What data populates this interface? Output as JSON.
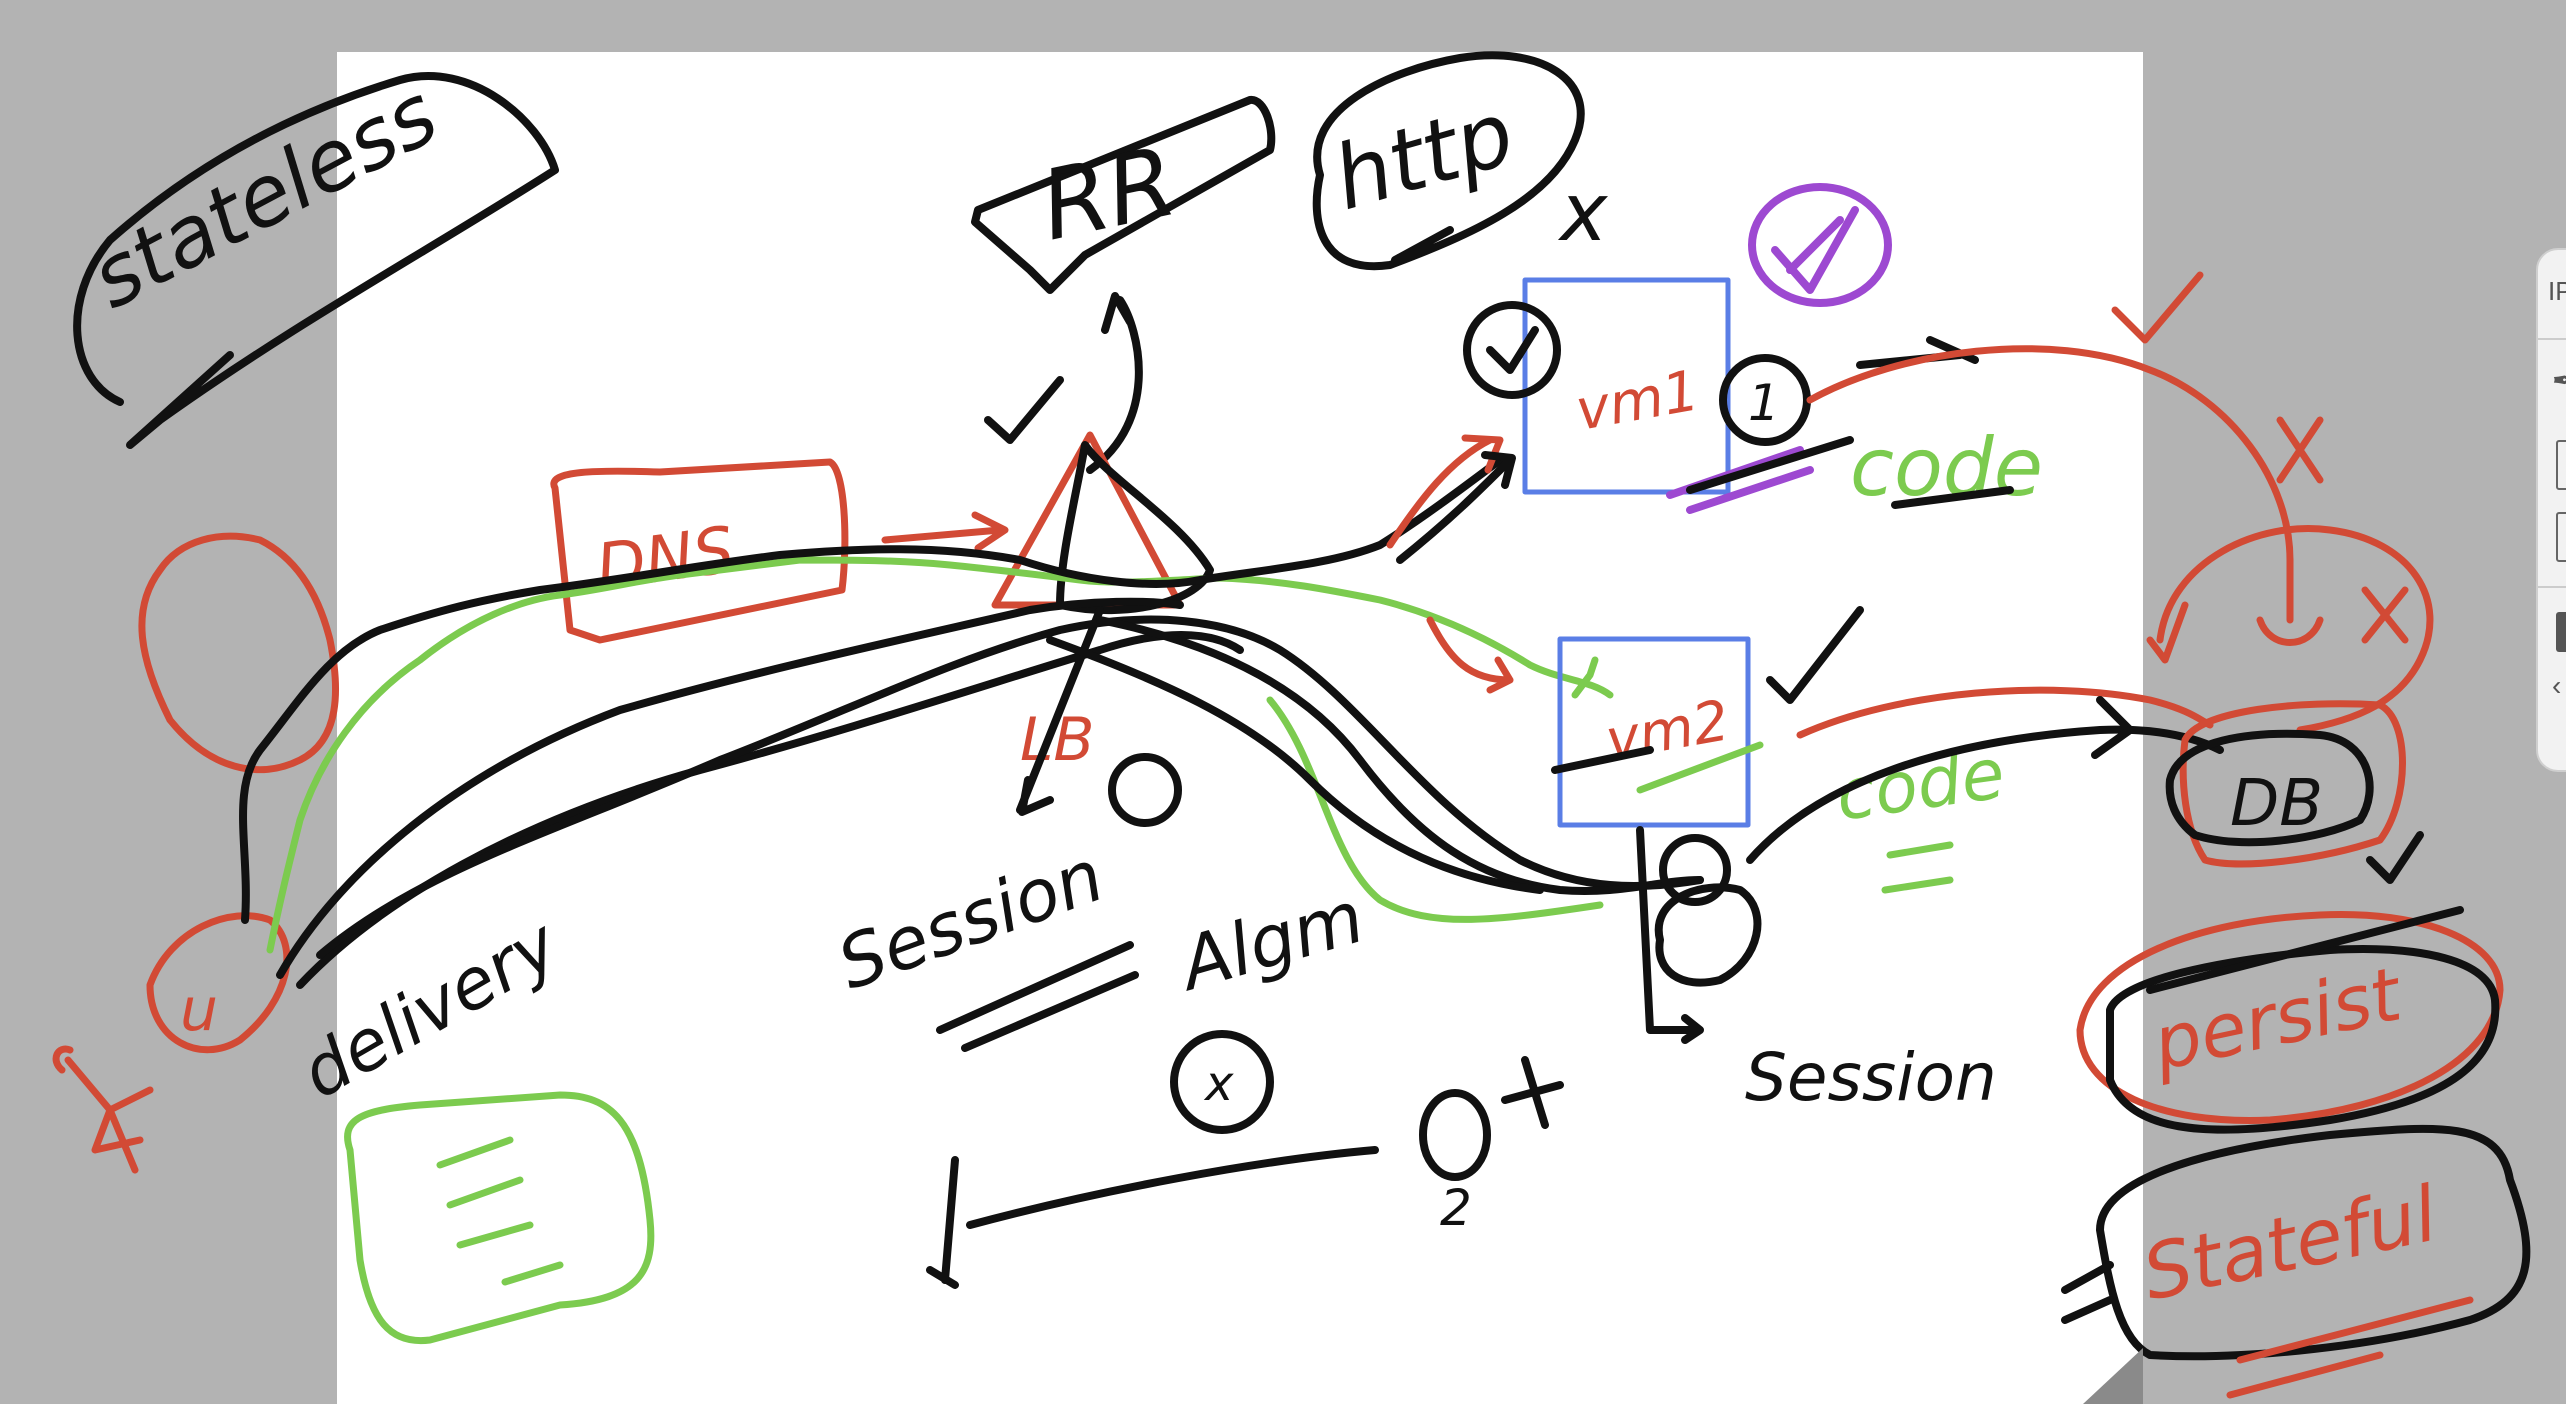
{
  "whiteboard": {
    "labels": {
      "stateless": "stateless",
      "rr": "RR",
      "http": "http",
      "dns": "DNS",
      "lb": "LB",
      "vm1": "vm1",
      "vm2": "vm2",
      "code1": "code",
      "code2": "code",
      "db": "DB",
      "persist": "persist",
      "stateful": "Stateful",
      "session1": "Session",
      "session2": "Session",
      "delivery": "delivery",
      "algm": "Algm",
      "u": "u",
      "node_1": "1",
      "node_2": "2",
      "x_mark": "x",
      "check_mark": "✓"
    },
    "colors": {
      "background": "#b3b3b3",
      "page": "#ffffff",
      "black_ink": "#111111",
      "red_ink": "#d24a35",
      "green_ink": "#7ccb4f",
      "purple_ink": "#9d49d1",
      "blue_box": "#5a7ee6"
    }
  },
  "side_panel": {
    "label": "IP",
    "glyph_top": "✒",
    "glyph_bottom": "‹"
  }
}
